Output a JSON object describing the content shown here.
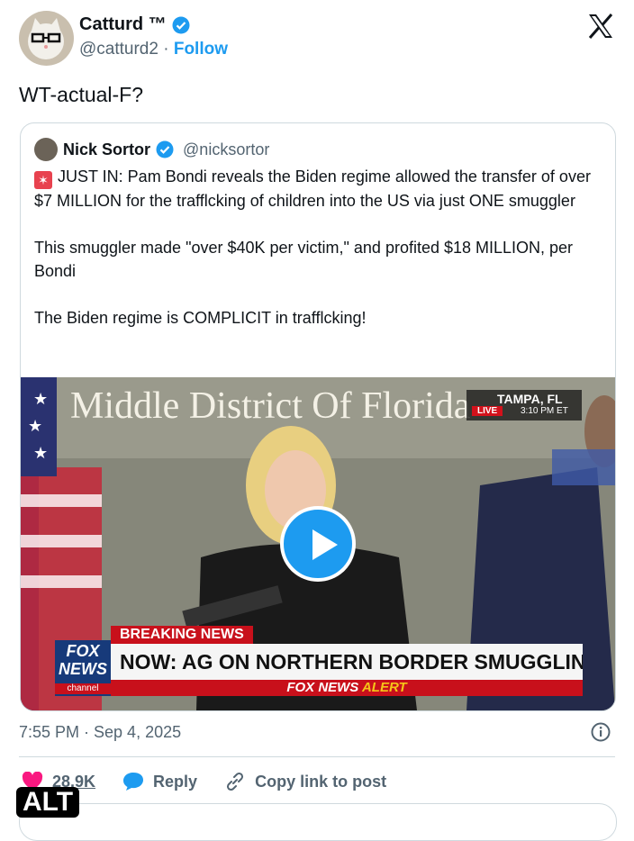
{
  "author": {
    "name": "Catturd ™",
    "handle": "@catturd2",
    "separator": "·",
    "follow_label": "Follow"
  },
  "tweet_text": "WT-actual-F?",
  "quoted": {
    "name": "Nick Sortor",
    "handle": "@nicksortor",
    "paragraphs": [
      "JUST IN: Pam Bondi reveals the Biden regime allowed the transfer of over $7 MILLION for the trafflcking of children into the US via just ONE smuggler",
      "This smuggler made \"over $40K per victim,\" and profited $18 MILLION, per Bondi",
      "The Biden regime is COMPLICIT in trafflcking!"
    ]
  },
  "video": {
    "sign_text": "Middle District Of Florida",
    "location": "TAMPA, FL",
    "live_label": "LIVE",
    "live_time": "3:10 PM ET",
    "breaking_label": "BREAKING NEWS",
    "headline": "NOW: AG ON NORTHERN BORDER SMUGGLING CRACKDOWN",
    "network_line1": "FOX",
    "network_line2": "NEWS",
    "network_line3": "channel",
    "alert_prefix": "FOX NEWS",
    "alert_suffix": "ALERT"
  },
  "timestamp": "7:55 PM · Sep 4, 2025",
  "actions": {
    "likes": "28.9K",
    "reply_label": "Reply",
    "copy_label": "Copy link to post"
  },
  "alt_badge": "ALT",
  "colors": {
    "accent": "#1d9bf0",
    "like": "#f91880",
    "fox_red": "#d3111b"
  }
}
